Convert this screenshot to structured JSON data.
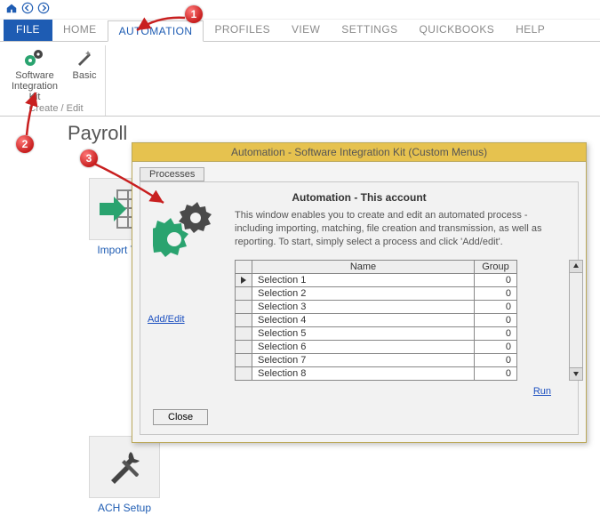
{
  "titlebar": {
    "home_icon": "home",
    "back_icon": "back",
    "fwd_icon": "forward"
  },
  "tabs": {
    "file": "FILE",
    "items": [
      "HOME",
      "AUTOMATION",
      "PROFILES",
      "VIEW",
      "SETTINGS",
      "QUICKBOOKS",
      "HELP"
    ],
    "active_index": 1
  },
  "ribbon": {
    "group_caption": "Create / Edit",
    "items": [
      {
        "label": "Software Integration Kit"
      },
      {
        "label": "Basic"
      }
    ]
  },
  "page_title": "Payroll",
  "tiles": {
    "import": "Import Tran",
    "ach": "ACH Setup"
  },
  "dialog": {
    "title": "Automation - Software Integration Kit (Custom Menus)",
    "tab_label": "Processes",
    "heading": "Automation - This account",
    "description": "This window enables you to create and edit an automated process - including importing, matching, file creation and transmission, as well as reporting.  To start, simply select a process and click 'Add/edit'.",
    "columns": {
      "name": "Name",
      "group": "Group"
    },
    "rows": [
      {
        "name": "Selection 1",
        "group": "0"
      },
      {
        "name": "Selection 2",
        "group": "0"
      },
      {
        "name": "Selection 3",
        "group": "0"
      },
      {
        "name": "Selection 4",
        "group": "0"
      },
      {
        "name": "Selection 5",
        "group": "0"
      },
      {
        "name": "Selection 6",
        "group": "0"
      },
      {
        "name": "Selection 7",
        "group": "0"
      },
      {
        "name": "Selection 8",
        "group": "0"
      }
    ],
    "add_edit": "Add/Edit",
    "run": "Run",
    "close": "Close"
  },
  "callouts": {
    "c1": "1",
    "c2": "2",
    "c3": "3"
  }
}
